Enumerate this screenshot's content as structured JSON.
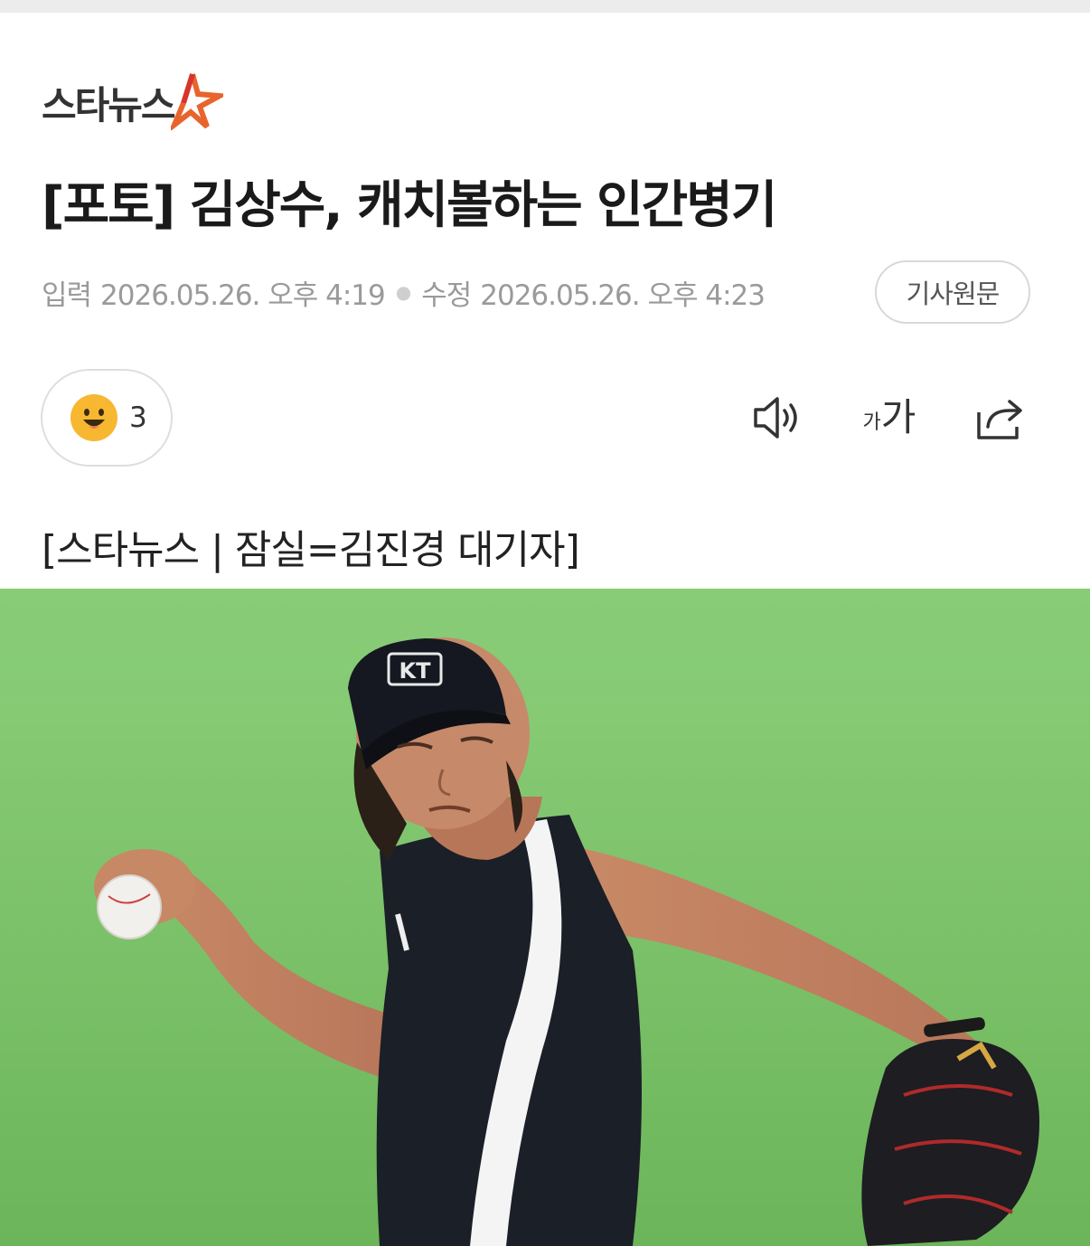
{
  "logo": {
    "text": "스타뉴스"
  },
  "article": {
    "title": "[포토] 김상수, 캐치볼하는 인간병기",
    "input_label": "입력",
    "input_time": "2026.05.26. 오후 4:19",
    "modified_label": "수정",
    "modified_time": "2026.05.26. 오후 4:23",
    "original_button": "기사원문",
    "byline": "[스타뉴스 | 잠실=김진경 대기자]"
  },
  "reactions": {
    "count": "3",
    "icon": "smiley-icon"
  },
  "toolbar": {
    "speaker_icon": "speaker-icon",
    "font_small": "가",
    "font_big": "가",
    "share_icon": "share-icon"
  },
  "photo": {
    "cap_logo": "KT"
  },
  "colors": {
    "logo_star_orange": "#e8642c",
    "logo_star_red": "#d9342b",
    "meta_gray": "#9a9a9a",
    "field_green": "#7cc26a",
    "uniform_black": "#1b1f27"
  }
}
